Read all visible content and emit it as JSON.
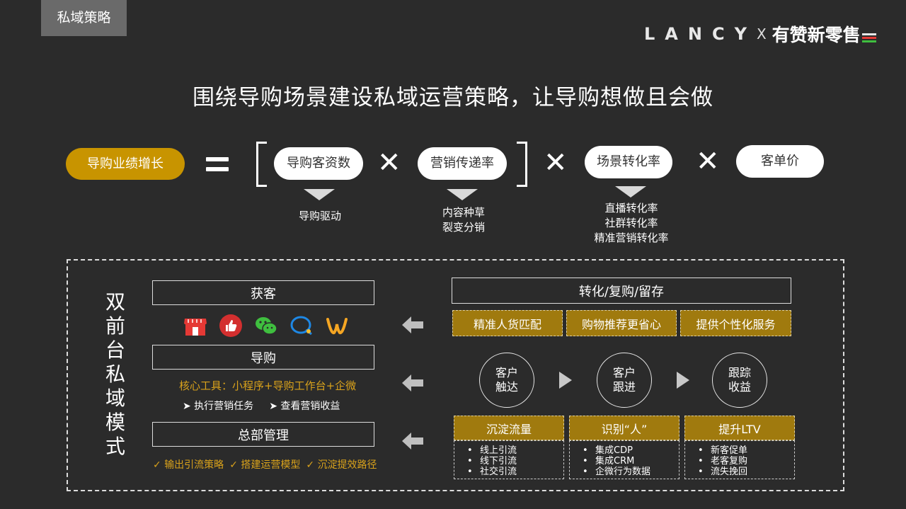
{
  "tag": "私域策略",
  "brand": {
    "lancy": "LANCY",
    "x": "X",
    "youzan": "有赞新零售",
    "bar_colors": [
      "#e8e8e8",
      "#e53935",
      "#3fbf3f"
    ]
  },
  "headline": "围绕导购场景建设私域运营策略，让导购想做且会做",
  "formula": {
    "result": "导购业绩增长",
    "terms": [
      "导购客资数",
      "营销传递率",
      "场景转化率",
      "客单价"
    ],
    "sub1": [
      "导购驱动"
    ],
    "sub2": [
      "内容种草",
      "裂变分销"
    ],
    "sub3": [
      "直播转化率",
      "社群转化率",
      "精准营销转化率"
    ]
  },
  "left": {
    "vertical_title": "双前台私域模式",
    "acquire": "获客",
    "guide": "导购",
    "core_tools": "核心工具：小程序+导购工作台+企微",
    "actions": [
      "执行营销任务",
      "查看营销收益"
    ],
    "hq": "总部管理",
    "outputs": [
      "输出引流策略",
      "搭建运营模型",
      "沉淀提效路径"
    ],
    "icons": [
      "store-icon",
      "thumbs-up-icon",
      "wechat-icon",
      "chat-bubble-icon",
      "weidian-icon"
    ]
  },
  "right": {
    "title": "转化/复购/留存",
    "services": [
      "精准人货匹配",
      "购物推荐更省心",
      "提供个性化服务"
    ],
    "steps": [
      [
        "客户",
        "触达"
      ],
      [
        "客户",
        "跟进"
      ],
      [
        "跟踪",
        "收益"
      ]
    ],
    "pillars": [
      {
        "title": "沉淀流量",
        "items": [
          "线上引流",
          "线下引流",
          "社交引流"
        ]
      },
      {
        "title": "识别“人”",
        "items": [
          "集成CDP",
          "集成CRM",
          "企微行为数据"
        ]
      },
      {
        "title": "提升LTV",
        "items": [
          "新客促单",
          "老客复购",
          "流失挽回"
        ]
      }
    ]
  }
}
